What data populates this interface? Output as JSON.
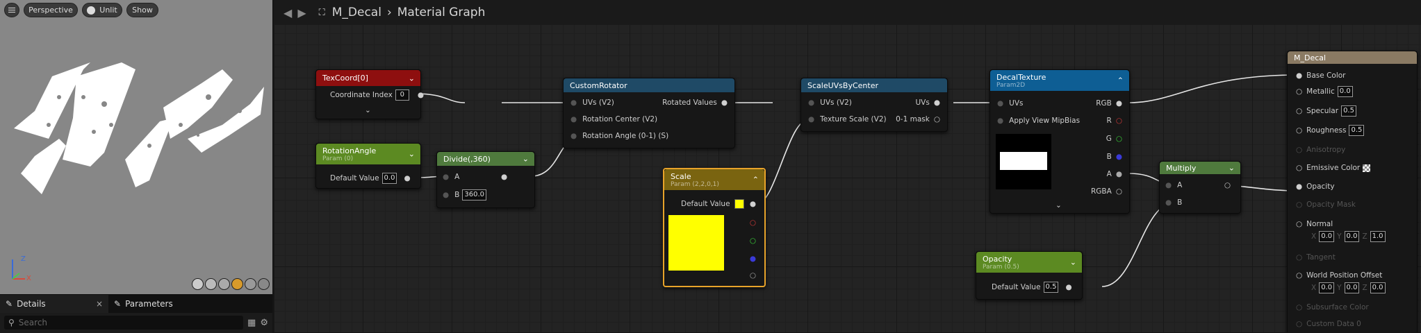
{
  "viewport": {
    "buttons": {
      "perspective": "Perspective",
      "unlit": "Unlit",
      "show": "Show"
    },
    "axis": {
      "z": "Z",
      "x": "X"
    }
  },
  "panel": {
    "tabs": {
      "details": "Details",
      "close": "×",
      "parameters": "Parameters"
    },
    "search_placeholder": "Search"
  },
  "breadcrumb": {
    "asset": "M_Decal",
    "separator": "›",
    "graph": "Material Graph"
  },
  "nodes": {
    "texcoord": {
      "title": "TexCoord[0]",
      "pin_label": "Coordinate Index",
      "pin_value": "0"
    },
    "rotation_angle": {
      "title": "RotationAngle",
      "subtitle": "Param (0)",
      "pin_label": "Default Value",
      "pin_value": "0.0"
    },
    "divide": {
      "title": "Divide(,360)",
      "pin_a": "A",
      "pin_b": "B",
      "pin_b_value": "360.0"
    },
    "custom_rotator": {
      "title": "CustomRotator",
      "in_uvs": "UVs (V2)",
      "in_center": "Rotation Center (V2)",
      "in_angle": "Rotation Angle (0-1) (S)",
      "out": "Rotated Values"
    },
    "scale": {
      "title": "Scale",
      "subtitle": "Param (2,2,0,1)",
      "pin_label": "Default Value",
      "color": "#ffff00"
    },
    "scale_uvs": {
      "title": "ScaleUVsByCenter",
      "in_uvs": "UVs (V2)",
      "in_scale": "Texture Scale (V2)",
      "out_uvs": "UVs",
      "out_mask": "0-1 mask"
    },
    "decal_texture": {
      "title": "DecalTexture",
      "subtitle": "Param2D",
      "in_uvs": "UVs",
      "in_mip": "Apply View MipBias",
      "out_rgb": "RGB",
      "out_r": "R",
      "out_g": "G",
      "out_b": "B",
      "out_a": "A",
      "out_rgba": "RGBA"
    },
    "multiply": {
      "title": "Multiply",
      "pin_a": "A",
      "pin_b": "B"
    },
    "opacity": {
      "title": "Opacity",
      "subtitle": "Param (0.5)",
      "pin_label": "Default Value",
      "pin_value": "0.5"
    },
    "material": {
      "title": "M_Decal",
      "base_color": "Base Color",
      "metallic": "Metallic",
      "metallic_value": "0.0",
      "specular": "Specular",
      "specular_value": "0.5",
      "roughness": "Roughness",
      "roughness_value": "0.5",
      "anisotropy": "Anisotropy",
      "emissive": "Emissive Color",
      "opacity": "Opacity",
      "opacity_mask": "Opacity Mask",
      "normal": "Normal",
      "normal_x": "0.0",
      "normal_y": "0.0",
      "normal_z": "1.0",
      "tangent": "Tangent",
      "wpo": "World Position Offset",
      "wpo_x": "0.0",
      "wpo_y": "0.0",
      "wpo_z": "0.0",
      "subsurface": "Subsurface Color",
      "custom_data": "Custom Data 0",
      "x": "X",
      "y": "Y",
      "z": "Z"
    }
  },
  "colors": {
    "texcoord_header": "#8e0f0f",
    "param_header": "#5c8a22",
    "divide_header": "#4f7a3d",
    "custom_header": "#1f4a66",
    "scale_header": "#7a6410",
    "texture_header": "#0e5e94",
    "material_header": "#8a7a63"
  }
}
